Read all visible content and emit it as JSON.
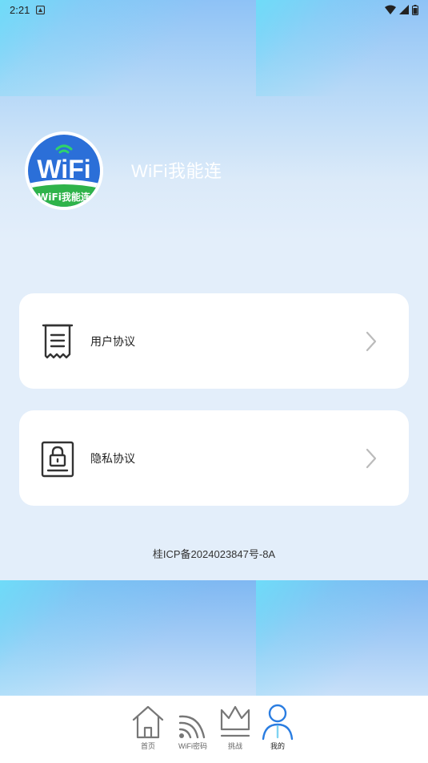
{
  "status_bar": {
    "time": "2:21"
  },
  "header": {
    "logo_text": "WiFi",
    "logo_ribbon": "WiFi我能连",
    "app_title": "WiFi我能连"
  },
  "menu": [
    {
      "label": "用户协议",
      "icon": "document-receipt-icon"
    },
    {
      "label": "隐私协议",
      "icon": "lock-document-icon"
    }
  ],
  "footer": {
    "icp": "桂ICP备2024023847号-8A"
  },
  "bottom_nav": [
    {
      "label": "首页",
      "icon": "home-icon"
    },
    {
      "label": "WiFi密码",
      "icon": "wifi-icon"
    },
    {
      "label": "挑战",
      "icon": "crown-icon"
    },
    {
      "label": "我的",
      "icon": "person-icon",
      "active": true
    }
  ],
  "colors": {
    "brand_blue": "#2c7be5",
    "accent_green": "#2fb34a",
    "nav_active": "#2a7de1"
  }
}
